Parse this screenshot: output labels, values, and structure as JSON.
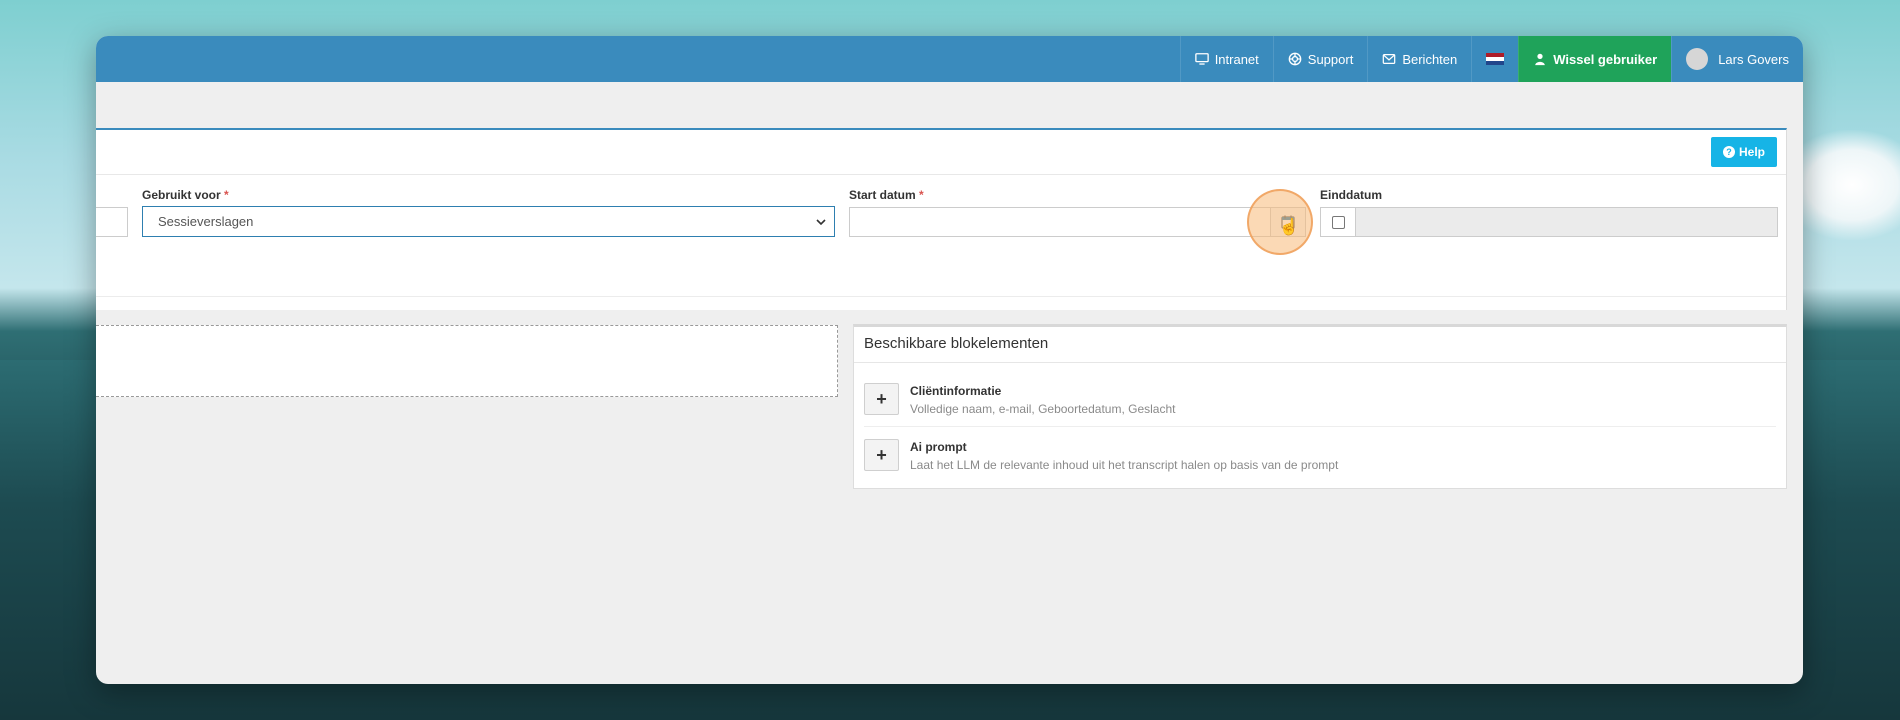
{
  "topbar": {
    "items": [
      {
        "icon": "monitor-icon",
        "label": "Intranet"
      },
      {
        "icon": "lifebuoy-icon",
        "label": "Support"
      },
      {
        "icon": "envelope-icon",
        "label": "Berichten"
      }
    ],
    "language_flag": "netherlands-flag-icon",
    "switch_user_label": "Wissel gebruiker",
    "user_name": "Lars Govers",
    "colors": {
      "bar": "#3a8bbd",
      "switch": "#1fa35a"
    }
  },
  "form": {
    "help_label": "Help",
    "used_for_label": "Gebruikt voor",
    "used_for_value": "Sessieverslagen",
    "start_date_label": "Start datum",
    "end_date_label": "Einddatum",
    "required_marker": "*"
  },
  "blocks": {
    "title": "Beschikbare blokelementen",
    "items": [
      {
        "name": "Cliëntinformatie",
        "description": "Volledige naam, e-mail, Geboortedatum, Geslacht"
      },
      {
        "name": "Ai prompt",
        "description": "Laat het LLM de relevante inhoud uit het transcript halen op basis van de prompt"
      }
    ]
  }
}
